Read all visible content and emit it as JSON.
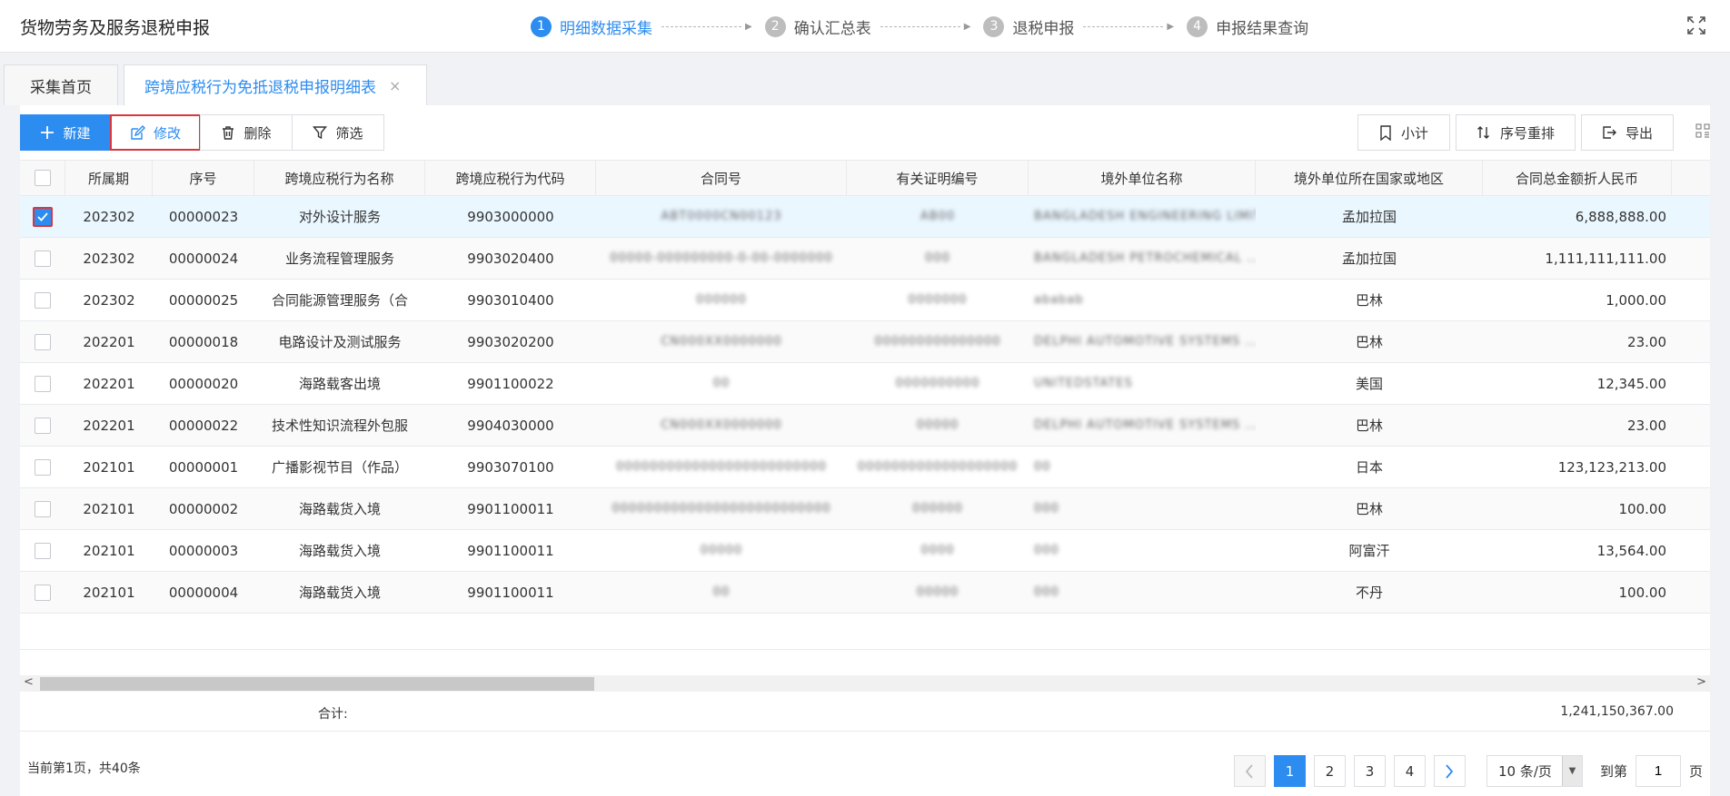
{
  "header": {
    "title": "货物劳务及服务退税申报",
    "steps": [
      {
        "num": "1",
        "label": "明细数据采集"
      },
      {
        "num": "2",
        "label": "确认汇总表"
      },
      {
        "num": "3",
        "label": "退税申报"
      },
      {
        "num": "4",
        "label": "申报结果查询"
      }
    ]
  },
  "tabs": {
    "home": "采集首页",
    "active": "跨境应税行为免抵退税申报明细表",
    "close": "×"
  },
  "toolbar": {
    "new": "新建",
    "edit": "修改",
    "delete": "删除",
    "filter": "筛选",
    "subtotal": "小计",
    "reorder": "序号重排",
    "export": "导出"
  },
  "table": {
    "columns": [
      "所属期",
      "序号",
      "跨境应税行为名称",
      "跨境应税行为代码",
      "合同号",
      "有关证明编号",
      "境外单位名称",
      "境外单位所在国家或地区",
      "合同总金额折人民币"
    ],
    "rows": [
      {
        "period": "202302",
        "seq": "00000023",
        "name": "对外设计服务",
        "code": "9903000000",
        "contract": "ABT0000CN00123",
        "cert": "AB00",
        "entity": "BANGLADESH ENGINEERING LIMITED ...",
        "country": "孟加拉国",
        "amount": "6,888,888.00",
        "checked": true
      },
      {
        "period": "202302",
        "seq": "00000024",
        "name": "业务流程管理服务",
        "code": "9903020400",
        "contract": "00000-000000000-0-00-0000000",
        "cert": "000",
        "entity": "BANGLADESH PETROCHEMICAL ...",
        "country": "孟加拉国",
        "amount": "1,111,111,111.00",
        "checked": false
      },
      {
        "period": "202302",
        "seq": "00000025",
        "name": "合同能源管理服务（合",
        "code": "9903010400",
        "contract": "000000",
        "cert": "0000000",
        "entity": "ababab",
        "country": "巴林",
        "amount": "1,000.00",
        "checked": false
      },
      {
        "period": "202201",
        "seq": "00000018",
        "name": "电路设计及测试服务",
        "code": "9903020200",
        "contract": "CN000XX0000000",
        "cert": "000000000000000",
        "entity": "DELPHI AUTOMOTIVE SYSTEMS ...",
        "country": "巴林",
        "amount": "23.00",
        "checked": false
      },
      {
        "period": "202201",
        "seq": "00000020",
        "name": "海路载客出境",
        "code": "9901100022",
        "contract": "00",
        "cert": "0000000000",
        "entity": "UNITEDSTATES",
        "country": "美国",
        "amount": "12,345.00",
        "checked": false
      },
      {
        "period": "202201",
        "seq": "00000022",
        "name": "技术性知识流程外包服",
        "code": "9904030000",
        "contract": "CN000XX0000000",
        "cert": "00000",
        "entity": "DELPHI AUTOMOTIVE SYSTEMS ...",
        "country": "巴林",
        "amount": "23.00",
        "checked": false
      },
      {
        "period": "202101",
        "seq": "00000001",
        "name": "广播影视节目（作品）",
        "code": "9903070100",
        "contract": "0000000000000000000000000",
        "cert": "0000000000000000000",
        "entity": "00",
        "country": "日本",
        "amount": "123,123,213.00",
        "checked": false
      },
      {
        "period": "202101",
        "seq": "00000002",
        "name": "海路载货入境",
        "code": "9901100011",
        "contract": "00000000000000000000000000",
        "cert": "000000",
        "entity": "000",
        "country": "巴林",
        "amount": "100.00",
        "checked": false
      },
      {
        "period": "202101",
        "seq": "00000003",
        "name": "海路载货入境",
        "code": "9901100011",
        "contract": "00000",
        "cert": "0000",
        "entity": "000",
        "country": "阿富汗",
        "amount": "13,564.00",
        "checked": false
      },
      {
        "period": "202101",
        "seq": "00000004",
        "name": "海路载货入境",
        "code": "9901100011",
        "contract": "00",
        "cert": "00000",
        "entity": "000",
        "country": "不丹",
        "amount": "100.00",
        "checked": false
      }
    ]
  },
  "summary": {
    "label": "合计:",
    "value": "1,241,150,367.00"
  },
  "pager": {
    "info": "当前第1页，共40条",
    "pages": [
      "1",
      "2",
      "3",
      "4"
    ],
    "page_size": "10 条/页",
    "goto_label": "到第",
    "goto_value": "1",
    "goto_suffix": "页"
  }
}
